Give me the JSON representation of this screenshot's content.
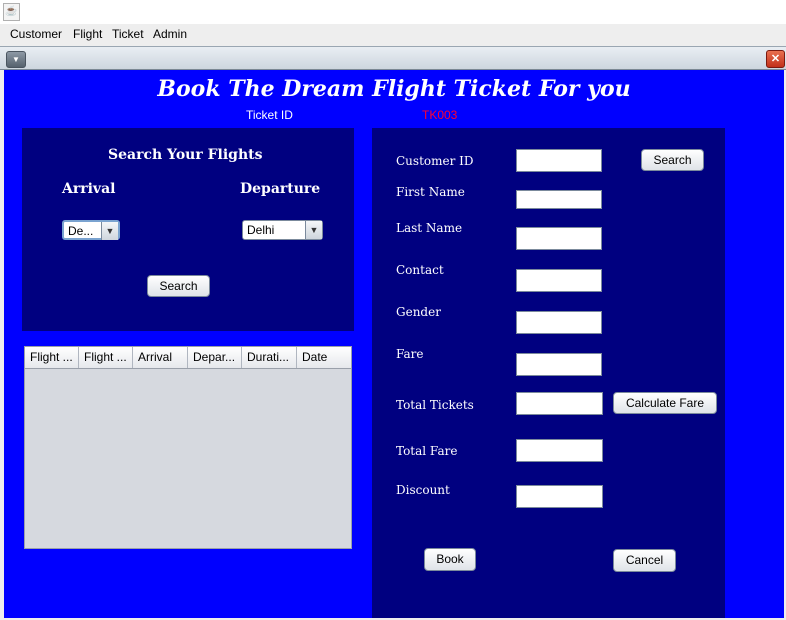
{
  "menubar": {
    "items": [
      "Customer",
      "Flight",
      "Ticket",
      "Admin"
    ]
  },
  "window": {
    "close_glyph": "✕",
    "system_menu_glyph": "▼"
  },
  "header": {
    "title": "Book The Dream Flight Ticket For you",
    "ticket_id_label": "Ticket ID",
    "ticket_id_value": "TK003"
  },
  "search_panel": {
    "title": "Search Your Flights",
    "arrival_label": "Arrival",
    "departure_label": "Departure",
    "arrival_value": "De...",
    "departure_value": "Delhi",
    "search_label": "Search"
  },
  "flights_table": {
    "columns": [
      "Flight ...",
      "Flight ...",
      "Arrival",
      "Depar...",
      "Durati...",
      "Date"
    ]
  },
  "booking_form": {
    "customer_id_label": "Customer ID",
    "first_name_label": "First Name",
    "last_name_label": "Last Name",
    "contact_label": "Contact",
    "gender_label": "Gender",
    "fare_label": "Fare",
    "total_tickets_label": "Total Tickets",
    "total_fare_label": "Total Fare",
    "discount_label": "Discount",
    "search_label": "Search",
    "calculate_label": "Calculate Fare",
    "book_label": "Book",
    "cancel_label": "Cancel"
  },
  "colors": {
    "background": "#0000ff",
    "panel": "#000080",
    "ticket_id": "#ff0030"
  }
}
